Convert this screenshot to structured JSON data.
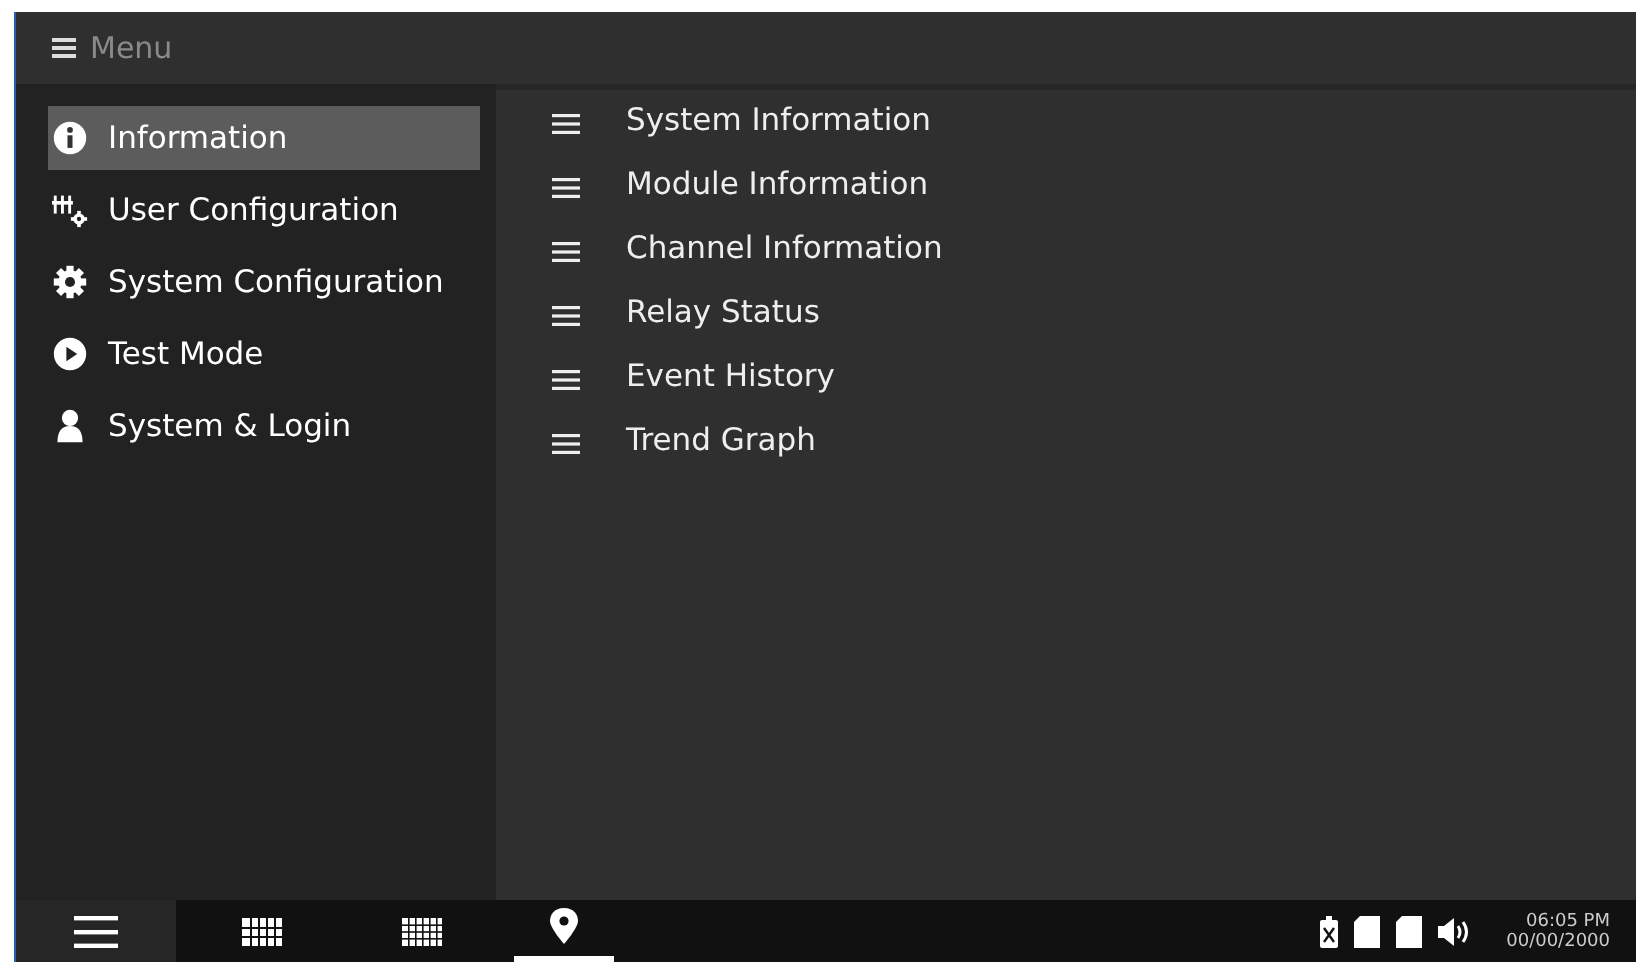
{
  "header": {
    "title": "Menu"
  },
  "sidebar": {
    "items": [
      {
        "label": "Information",
        "kind": "info",
        "selected": true
      },
      {
        "label": "User Configuration",
        "kind": "sliders",
        "selected": false
      },
      {
        "label": "System Configuration",
        "kind": "gear",
        "selected": false
      },
      {
        "label": "Test Mode",
        "kind": "play",
        "selected": false
      },
      {
        "label": "System & Login",
        "kind": "user",
        "selected": false
      }
    ]
  },
  "submenu": {
    "items": [
      {
        "label": "System Information"
      },
      {
        "label": "Module Information"
      },
      {
        "label": "Channel Information"
      },
      {
        "label": "Relay Status"
      },
      {
        "label": "Event History"
      },
      {
        "label": "Trend Graph"
      }
    ]
  },
  "taskbar": {
    "buttons": [
      {
        "kind": "menu",
        "selected": true
      },
      {
        "kind": "grid",
        "selected": false
      },
      {
        "kind": "finegrid",
        "selected": false
      },
      {
        "kind": "pin",
        "selected": true
      }
    ],
    "time": "06:05 PM",
    "date": "00/00/2000"
  }
}
